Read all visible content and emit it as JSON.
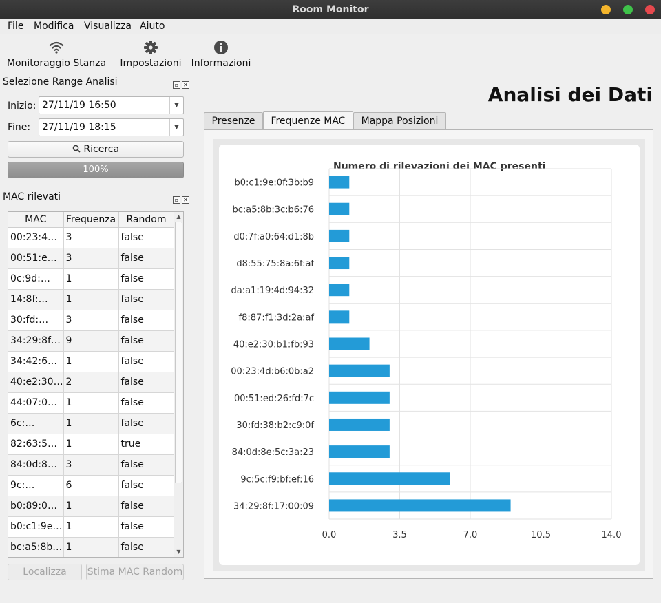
{
  "window": {
    "title": "Room Monitor"
  },
  "menu": [
    "File",
    "Modifica",
    "Visualizza",
    "Aiuto"
  ],
  "toolbar": {
    "monitor_label": "Monitoraggio Stanza",
    "settings_label": "Impostazioni",
    "info_label": "Informazioni"
  },
  "range_panel": {
    "title": "Selezione Range Analisi",
    "start_label": "Inizio:",
    "start_value": "27/11/19 16:50",
    "end_label": "Fine:",
    "end_value": "27/11/19 18:15",
    "search_label": "Ricerca",
    "progress_text": "100%",
    "progress_value": 100
  },
  "mac_panel": {
    "title": "MAC rilevati",
    "columns": [
      "MAC",
      "Frequenza",
      "Random"
    ],
    "rows": [
      [
        "00:23:4…",
        "3",
        "false"
      ],
      [
        "00:51:e…",
        "3",
        "false"
      ],
      [
        "0c:9d:…",
        "1",
        "false"
      ],
      [
        "14:8f:…",
        "1",
        "false"
      ],
      [
        "30:fd:…",
        "3",
        "false"
      ],
      [
        "34:29:8f…",
        "9",
        "false"
      ],
      [
        "34:42:6…",
        "1",
        "false"
      ],
      [
        "40:e2:30…",
        "2",
        "false"
      ],
      [
        "44:07:0…",
        "1",
        "false"
      ],
      [
        "6c:…",
        "1",
        "false"
      ],
      [
        "82:63:5…",
        "1",
        "true"
      ],
      [
        "84:0d:8…",
        "3",
        "false"
      ],
      [
        "9c:…",
        "6",
        "false"
      ],
      [
        "b0:89:0…",
        "1",
        "false"
      ],
      [
        "b0:c1:9e…",
        "1",
        "false"
      ],
      [
        "bc:a5:8b…",
        "1",
        "false"
      ]
    ],
    "localize_label": "Localizza",
    "estimate_label": "Stima MAC Random"
  },
  "main": {
    "title": "Analisi dei Dati",
    "tabs": [
      {
        "label": "Presenze",
        "active": false
      },
      {
        "label": "Frequenze MAC",
        "active": true
      },
      {
        "label": "Mappa Posizioni",
        "active": false
      }
    ]
  },
  "chart_data": {
    "type": "bar",
    "orientation": "horizontal",
    "title": "Numero di rilevazioni dei MAC presenti",
    "categories": [
      "b0:c1:9e:0f:3b:b9",
      "bc:a5:8b:3c:b6:76",
      "d0:7f:a0:64:d1:8b",
      "d8:55:75:8a:6f:af",
      "da:a1:19:4d:94:32",
      "f8:87:f1:3d:2a:af",
      "40:e2:30:b1:fb:93",
      "00:23:4d:b6:0b:a2",
      "00:51:ed:26:fd:7c",
      "30:fd:38:b2:c9:0f",
      "84:0d:8e:5c:3a:23",
      "9c:5c:f9:bf:ef:16",
      "34:29:8f:17:00:09"
    ],
    "values": [
      1,
      1,
      1,
      1,
      1,
      1,
      2,
      3,
      3,
      3,
      3,
      6,
      9
    ],
    "xlim": [
      0,
      14
    ],
    "xticks": [
      "0.0",
      "3.5",
      "7.0",
      "10.5",
      "14.0"
    ],
    "xtick_values": [
      0,
      3.5,
      7,
      10.5,
      14
    ],
    "bar_color": "#239bd7",
    "grid": true
  }
}
